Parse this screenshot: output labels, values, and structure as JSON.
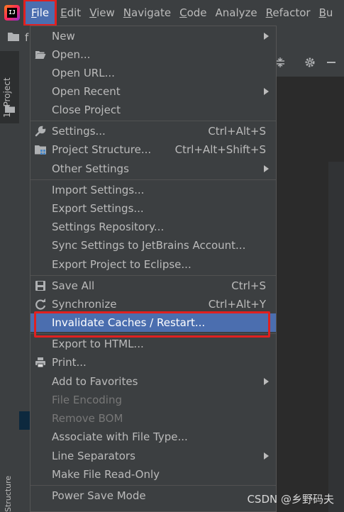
{
  "menubar": {
    "items": [
      {
        "label": "File",
        "underline": "F",
        "rest": "ile"
      },
      {
        "label": "Edit",
        "underline": "E",
        "rest": "dit"
      },
      {
        "label": "View",
        "underline": "V",
        "rest": "iew"
      },
      {
        "label": "Navigate",
        "underline": "N",
        "rest": "avigate"
      },
      {
        "label": "Code",
        "underline": "C",
        "rest": "ode"
      },
      {
        "label": "Analyze",
        "underline": "",
        "rest": "Analyze"
      },
      {
        "label": "Refactor",
        "underline": "R",
        "rest": "efactor"
      },
      {
        "label": "Bu",
        "underline": "B",
        "rest": "u"
      }
    ]
  },
  "sidebar": {
    "project_tab": "1: Project",
    "structure_tab": "Structure",
    "project_name_fragment": "f"
  },
  "file_menu": {
    "items": [
      {
        "label": "New",
        "shortcut": "",
        "submenu": true,
        "disabled": false,
        "icon": ""
      },
      {
        "label": "Open...",
        "shortcut": "",
        "submenu": false,
        "disabled": false,
        "icon": "folder-open-icon"
      },
      {
        "label": "Open URL...",
        "shortcut": "",
        "submenu": false,
        "disabled": false,
        "icon": ""
      },
      {
        "label": "Open Recent",
        "shortcut": "",
        "submenu": true,
        "disabled": false,
        "icon": ""
      },
      {
        "label": "Close Project",
        "shortcut": "",
        "submenu": false,
        "disabled": false,
        "icon": ""
      },
      {
        "label": "Settings...",
        "shortcut": "Ctrl+Alt+S",
        "submenu": false,
        "disabled": false,
        "icon": "wrench-icon"
      },
      {
        "label": "Project Structure...",
        "shortcut": "Ctrl+Alt+Shift+S",
        "submenu": false,
        "disabled": false,
        "icon": "project-structure-icon"
      },
      {
        "label": "Other Settings",
        "shortcut": "",
        "submenu": true,
        "disabled": false,
        "icon": ""
      },
      {
        "label": "Import Settings...",
        "shortcut": "",
        "submenu": false,
        "disabled": false,
        "icon": ""
      },
      {
        "label": "Export Settings...",
        "shortcut": "",
        "submenu": false,
        "disabled": false,
        "icon": ""
      },
      {
        "label": "Settings Repository...",
        "shortcut": "",
        "submenu": false,
        "disabled": false,
        "icon": ""
      },
      {
        "label": "Sync Settings to JetBrains Account...",
        "shortcut": "",
        "submenu": false,
        "disabled": false,
        "icon": ""
      },
      {
        "label": "Export Project to Eclipse...",
        "shortcut": "",
        "submenu": false,
        "disabled": false,
        "icon": ""
      },
      {
        "label": "Save All",
        "shortcut": "Ctrl+S",
        "submenu": false,
        "disabled": false,
        "icon": "save-icon"
      },
      {
        "label": "Synchronize",
        "shortcut": "Ctrl+Alt+Y",
        "submenu": false,
        "disabled": false,
        "icon": "refresh-icon"
      },
      {
        "label": "Invalidate Caches / Restart...",
        "shortcut": "",
        "submenu": false,
        "disabled": false,
        "icon": "",
        "highlighted": true
      },
      {
        "label": "Export to HTML...",
        "shortcut": "",
        "submenu": false,
        "disabled": false,
        "icon": ""
      },
      {
        "label": "Print...",
        "shortcut": "",
        "submenu": false,
        "disabled": false,
        "icon": "printer-icon"
      },
      {
        "label": "Add to Favorites",
        "shortcut": "",
        "submenu": true,
        "disabled": false,
        "icon": ""
      },
      {
        "label": "File Encoding",
        "shortcut": "",
        "submenu": false,
        "disabled": true,
        "icon": ""
      },
      {
        "label": "Remove BOM",
        "shortcut": "",
        "submenu": false,
        "disabled": true,
        "icon": ""
      },
      {
        "label": "Associate with File Type...",
        "shortcut": "",
        "submenu": false,
        "disabled": false,
        "icon": ""
      },
      {
        "label": "Line Separators",
        "shortcut": "",
        "submenu": true,
        "disabled": false,
        "icon": ""
      },
      {
        "label": "Make File Read-Only",
        "shortcut": "",
        "submenu": false,
        "disabled": false,
        "icon": ""
      },
      {
        "label": "Power Save Mode",
        "shortcut": "",
        "submenu": false,
        "disabled": false,
        "icon": ""
      }
    ]
  },
  "watermark": "CSDN @乡野码夫",
  "colors": {
    "menubar_bg": "#3c3f41",
    "selection": "#4b6eaf",
    "annotation_red": "#e02020"
  }
}
